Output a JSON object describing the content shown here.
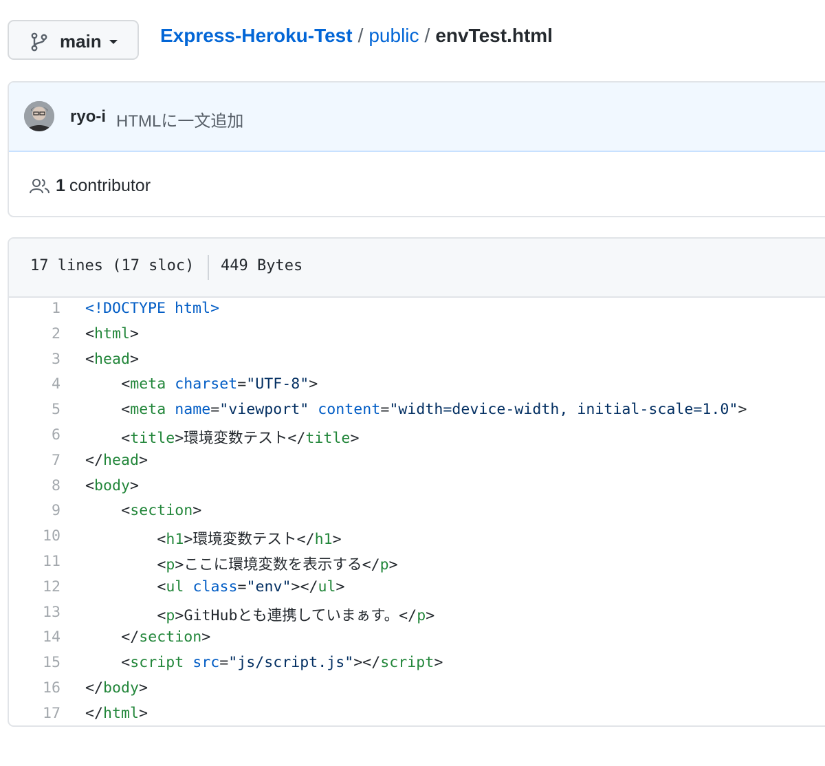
{
  "branch": {
    "label": "main",
    "icon": "git-branch-icon"
  },
  "breadcrumb": {
    "repo": "Express-Heroku-Test",
    "separator": "/",
    "folder": "public",
    "file": "envTest.html"
  },
  "commit": {
    "author": "ryo-i",
    "message": "HTMLに一文追加"
  },
  "contributors": {
    "count": "1",
    "label": "contributor"
  },
  "file_info": {
    "lines": "17 lines (17 sloc)",
    "size": "449 Bytes"
  },
  "code_lines": [
    {
      "num": "1",
      "indent": 0,
      "tokens": [
        [
          "doctype",
          "<!DOCTYPE html>"
        ]
      ]
    },
    {
      "num": "2",
      "indent": 0,
      "tokens": [
        [
          "punct",
          "<"
        ],
        [
          "tag",
          "html"
        ],
        [
          "punct",
          ">"
        ]
      ]
    },
    {
      "num": "3",
      "indent": 0,
      "tokens": [
        [
          "punct",
          "<"
        ],
        [
          "tag",
          "head"
        ],
        [
          "punct",
          ">"
        ]
      ]
    },
    {
      "num": "4",
      "indent": 4,
      "tokens": [
        [
          "punct",
          "<"
        ],
        [
          "tag",
          "meta"
        ],
        [
          "text",
          " "
        ],
        [
          "attr",
          "charset"
        ],
        [
          "punct",
          "="
        ],
        [
          "str",
          "\"UTF-8\""
        ],
        [
          "punct",
          ">"
        ]
      ]
    },
    {
      "num": "5",
      "indent": 4,
      "tokens": [
        [
          "punct",
          "<"
        ],
        [
          "tag",
          "meta"
        ],
        [
          "text",
          " "
        ],
        [
          "attr",
          "name"
        ],
        [
          "punct",
          "="
        ],
        [
          "str",
          "\"viewport\""
        ],
        [
          "text",
          " "
        ],
        [
          "attr",
          "content"
        ],
        [
          "punct",
          "="
        ],
        [
          "str",
          "\"width=device-width, initial-scale=1.0\""
        ],
        [
          "punct",
          ">"
        ]
      ]
    },
    {
      "num": "6",
      "indent": 4,
      "tokens": [
        [
          "punct",
          "<"
        ],
        [
          "tag",
          "title"
        ],
        [
          "punct",
          ">"
        ],
        [
          "text",
          "環境変数テスト"
        ],
        [
          "punct",
          "</"
        ],
        [
          "tag",
          "title"
        ],
        [
          "punct",
          ">"
        ]
      ]
    },
    {
      "num": "7",
      "indent": 0,
      "tokens": [
        [
          "punct",
          "</"
        ],
        [
          "tag",
          "head"
        ],
        [
          "punct",
          ">"
        ]
      ]
    },
    {
      "num": "8",
      "indent": 0,
      "tokens": [
        [
          "punct",
          "<"
        ],
        [
          "tag",
          "body"
        ],
        [
          "punct",
          ">"
        ]
      ]
    },
    {
      "num": "9",
      "indent": 4,
      "tokens": [
        [
          "punct",
          "<"
        ],
        [
          "tag",
          "section"
        ],
        [
          "punct",
          ">"
        ]
      ]
    },
    {
      "num": "10",
      "indent": 8,
      "tokens": [
        [
          "punct",
          "<"
        ],
        [
          "tag",
          "h1"
        ],
        [
          "punct",
          ">"
        ],
        [
          "text",
          "環境変数テスト"
        ],
        [
          "punct",
          "</"
        ],
        [
          "tag",
          "h1"
        ],
        [
          "punct",
          ">"
        ]
      ]
    },
    {
      "num": "11",
      "indent": 8,
      "tokens": [
        [
          "punct",
          "<"
        ],
        [
          "tag",
          "p"
        ],
        [
          "punct",
          ">"
        ],
        [
          "text",
          "ここに環境変数を表示する"
        ],
        [
          "punct",
          "</"
        ],
        [
          "tag",
          "p"
        ],
        [
          "punct",
          ">"
        ]
      ]
    },
    {
      "num": "12",
      "indent": 8,
      "tokens": [
        [
          "punct",
          "<"
        ],
        [
          "tag",
          "ul"
        ],
        [
          "text",
          " "
        ],
        [
          "attr",
          "class"
        ],
        [
          "punct",
          "="
        ],
        [
          "str",
          "\"env\""
        ],
        [
          "punct",
          "></"
        ],
        [
          "tag",
          "ul"
        ],
        [
          "punct",
          ">"
        ]
      ]
    },
    {
      "num": "13",
      "indent": 8,
      "tokens": [
        [
          "punct",
          "<"
        ],
        [
          "tag",
          "p"
        ],
        [
          "punct",
          ">"
        ],
        [
          "text",
          "GitHubとも連携していまぁす。"
        ],
        [
          "punct",
          "</"
        ],
        [
          "tag",
          "p"
        ],
        [
          "punct",
          ">"
        ]
      ]
    },
    {
      "num": "14",
      "indent": 4,
      "tokens": [
        [
          "punct",
          "</"
        ],
        [
          "tag",
          "section"
        ],
        [
          "punct",
          ">"
        ]
      ]
    },
    {
      "num": "15",
      "indent": 4,
      "tokens": [
        [
          "punct",
          "<"
        ],
        [
          "tag",
          "script"
        ],
        [
          "text",
          " "
        ],
        [
          "attr",
          "src"
        ],
        [
          "punct",
          "="
        ],
        [
          "str",
          "\"js/script.js\""
        ],
        [
          "punct",
          "></"
        ],
        [
          "tag",
          "script"
        ],
        [
          "punct",
          ">"
        ]
      ]
    },
    {
      "num": "16",
      "indent": 0,
      "tokens": [
        [
          "punct",
          "</"
        ],
        [
          "tag",
          "body"
        ],
        [
          "punct",
          ">"
        ]
      ]
    },
    {
      "num": "17",
      "indent": 0,
      "tokens": [
        [
          "punct",
          "</"
        ],
        [
          "tag",
          "html"
        ],
        [
          "punct",
          ">"
        ]
      ]
    }
  ],
  "colors": {
    "link": "#0366d6",
    "tag": "#22863a",
    "attr": "#005cc5",
    "string": "#032f62",
    "commit_bg": "#f1f8ff"
  }
}
